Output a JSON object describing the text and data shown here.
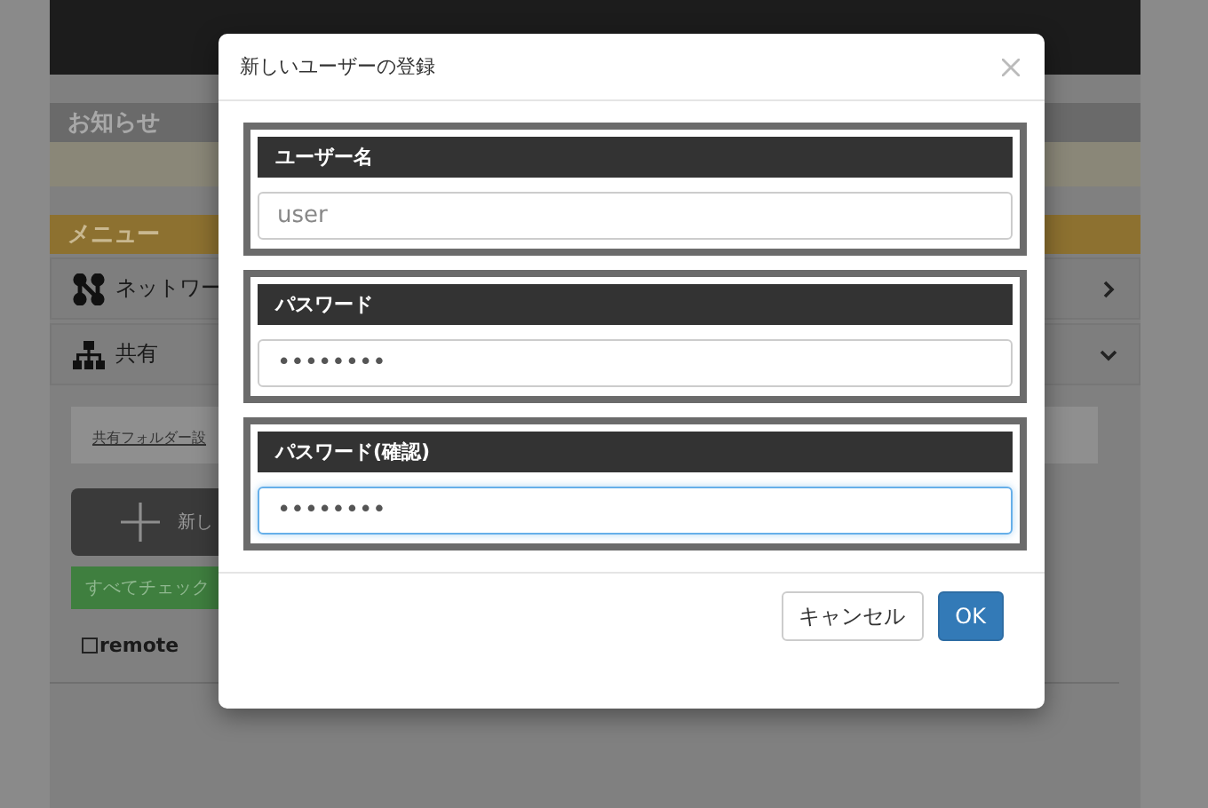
{
  "page": {
    "notice": {
      "title": "お知らせ"
    },
    "menu": {
      "title": "メニュー",
      "items": [
        {
          "kind": "network",
          "label": "ネットワー",
          "expanded": false
        },
        {
          "kind": "share",
          "label": "共有",
          "expanded": true
        }
      ]
    },
    "share": {
      "link": "共有フォルダー設",
      "new_button": "新し",
      "check_all": "すべてチェック",
      "folders": [
        {
          "label": "remote",
          "checked": false
        }
      ]
    }
  },
  "dialog": {
    "title": "新しいユーザーの登録",
    "fields": [
      {
        "label": "ユーザー名",
        "placeholder": "user",
        "focused": false
      },
      {
        "label": "パスワード",
        "value": "••••••••",
        "focused": false
      },
      {
        "label": "パスワード(確認)",
        "value": "••••••••",
        "focused": true
      }
    ],
    "buttons": [
      {
        "label": "キャンセル",
        "kind": "default"
      },
      {
        "label": "OK",
        "kind": "primary"
      }
    ]
  }
}
